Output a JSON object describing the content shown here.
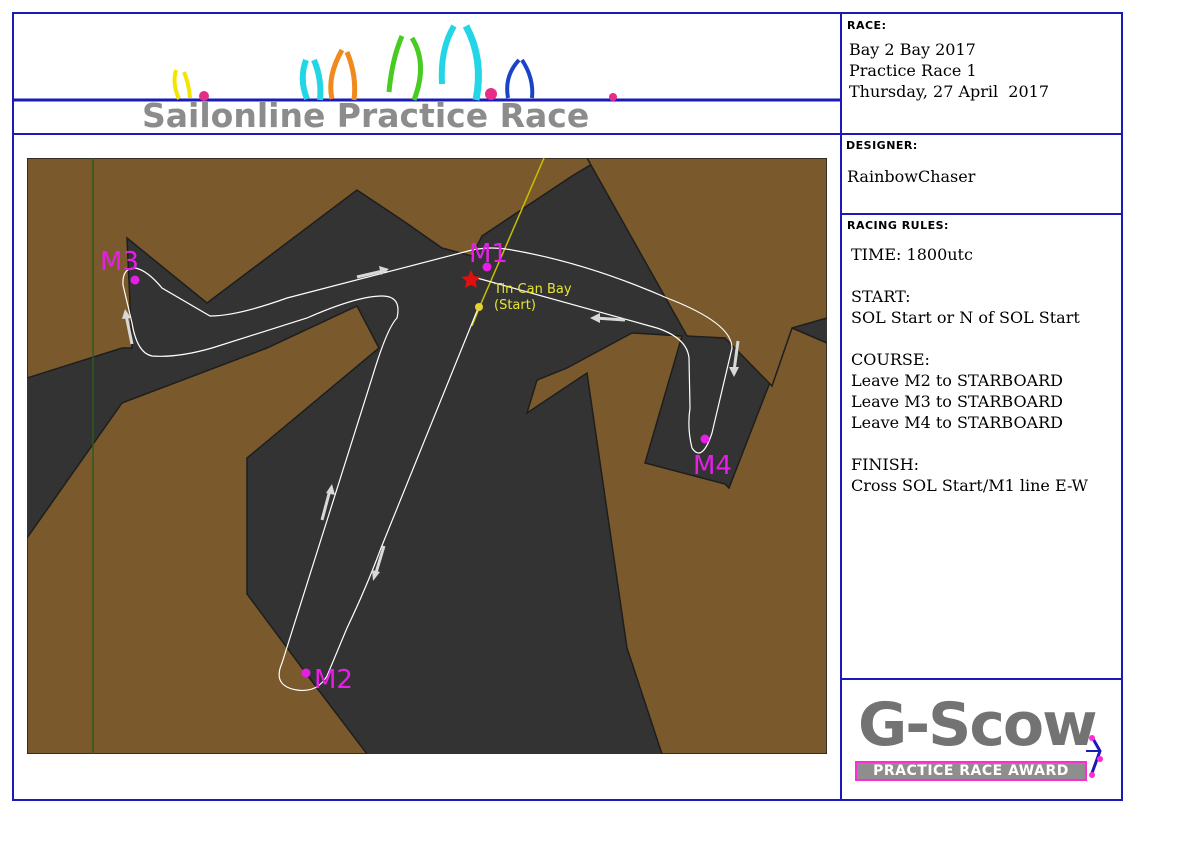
{
  "header": {
    "title": "Sailonline Practice Race"
  },
  "race_panel": {
    "label": "RACE:",
    "lines": [
      "Bay 2 Bay 2017",
      "Practice Race 1",
      "Thursday, 27 April  2017"
    ]
  },
  "designer_panel": {
    "label": "DESIGNER:",
    "name": "RainbowChaser"
  },
  "rules_panel": {
    "label": "RACING RULES:",
    "time": "TIME: 1800utc",
    "start_heading": "START:",
    "start_text": "SOL Start or N of SOL Start",
    "course_heading": "COURSE:",
    "course_lines": [
      "Leave M2 to STARBOARD",
      "Leave M3 to STARBOARD",
      "Leave M4 to STARBOARD"
    ],
    "finish_heading": "FINISH:",
    "finish_text": "Cross SOL Start/M1 line E-W"
  },
  "award": {
    "title": "G-Scow",
    "subtitle": "PRACTICE RACE AWARD"
  },
  "map": {
    "start_label_line1": "Tin Can Bay",
    "start_label_line2": "(Start)",
    "marks": [
      "M1",
      "M2",
      "M3",
      "M4"
    ]
  },
  "colors": {
    "border": "#1a1ab8",
    "water": "#333333",
    "land": "#7a5a2c",
    "mark": "#e61ee6",
    "start_label": "#e6e632",
    "start_star": "#e01010"
  }
}
